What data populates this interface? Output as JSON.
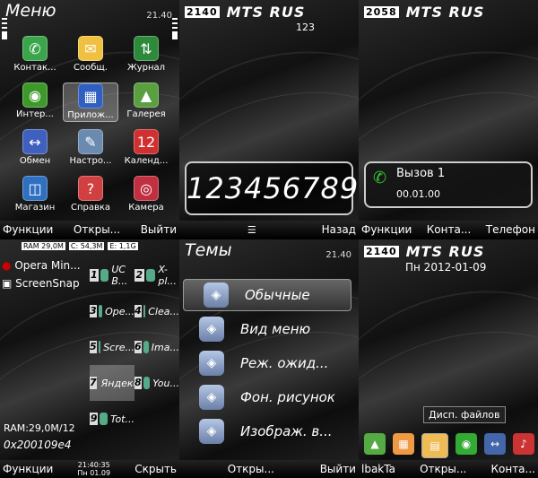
{
  "panels": {
    "menu": {
      "title": "Меню",
      "time": "21.40",
      "apps": [
        {
          "label": "Контак...",
          "icon": "contacts-icon",
          "glyph": "✆",
          "color": "#3aa54a"
        },
        {
          "label": "Сообщ.",
          "icon": "messages-icon",
          "glyph": "✉",
          "color": "#f0c040"
        },
        {
          "label": "Журнал",
          "icon": "log-icon",
          "glyph": "⇅",
          "color": "#2c8a3a"
        },
        {
          "label": "Интер...",
          "icon": "internet-icon",
          "glyph": "◉",
          "color": "#3d9a2a"
        },
        {
          "label": "Прилож...",
          "icon": "apps-icon",
          "glyph": "▦",
          "color": "#2f5fbf"
        },
        {
          "label": "Галерея",
          "icon": "gallery-icon",
          "glyph": "▲",
          "color": "#5aa040"
        },
        {
          "label": "Обмен",
          "icon": "exchange-icon",
          "glyph": "↔",
          "color": "#4060c0"
        },
        {
          "label": "Настро...",
          "icon": "settings-icon",
          "glyph": "✎",
          "color": "#6a8ab0"
        },
        {
          "label": "Календ...",
          "icon": "calendar-icon",
          "glyph": "12",
          "color": "#d03030"
        },
        {
          "label": "Магазин",
          "icon": "store-icon",
          "glyph": "◫",
          "color": "#3070c0"
        },
        {
          "label": "Справка",
          "icon": "help-icon",
          "glyph": "?",
          "color": "#d04040"
        },
        {
          "label": "Камера",
          "icon": "camera-icon",
          "glyph": "◎",
          "color": "#c03040"
        }
      ],
      "soft_left": "Функции",
      "soft_mid": "Откры...",
      "soft_right": "Выйти"
    },
    "dial": {
      "num": "2140",
      "op": "MTS RUS",
      "signal": "123",
      "number": "123456789",
      "soft_right": "Назад"
    },
    "call": {
      "num": "2058",
      "op": "MTS RUS",
      "name": "Вызов 1",
      "duration": "00.01.00",
      "soft_left": "Функции",
      "soft_mid": "Конта...",
      "soft_right": "Телефон"
    },
    "tasks": {
      "ram": "RAM 29,0M",
      "c": "C: 54,3M",
      "e": "E: 1,1G",
      "left_items": [
        "Opera Min...",
        "ScreenSnap"
      ],
      "tasks": [
        {
          "n": "1",
          "label": "UC B..."
        },
        {
          "n": "2",
          "label": "X-pl..."
        },
        {
          "n": "3",
          "label": "Ope..."
        },
        {
          "n": "4",
          "label": "Clea..."
        },
        {
          "n": "5",
          "label": "Scre..."
        },
        {
          "n": "6",
          "label": "Ima..."
        },
        {
          "n": "7",
          "label": "Яндекс"
        },
        {
          "n": "8",
          "label": "You..."
        },
        {
          "n": "9",
          "label": "Tot..."
        }
      ],
      "ram_full": "RAM:29,0M/12",
      "addr": "0x200109e4",
      "clock": "21:40:35",
      "date": "Пн 01.09",
      "soft_left": "Функции",
      "soft_right": "Скрыть"
    },
    "themes": {
      "title": "Темы",
      "time": "21.40",
      "items": [
        "Обычные",
        "Вид меню",
        "Реж. ожид...",
        "Фон. рисунок",
        "Изображ. в..."
      ],
      "soft_mid": "Откры...",
      "soft_right": "Выйти"
    },
    "home": {
      "num": "2140",
      "op": "MTS RUS",
      "date": "Пн 2012-01-09",
      "tooltip": "Дисп. файлов",
      "soft_left": "lbakTa",
      "soft_mid": "Откры...",
      "soft_right": "Конта..."
    }
  }
}
